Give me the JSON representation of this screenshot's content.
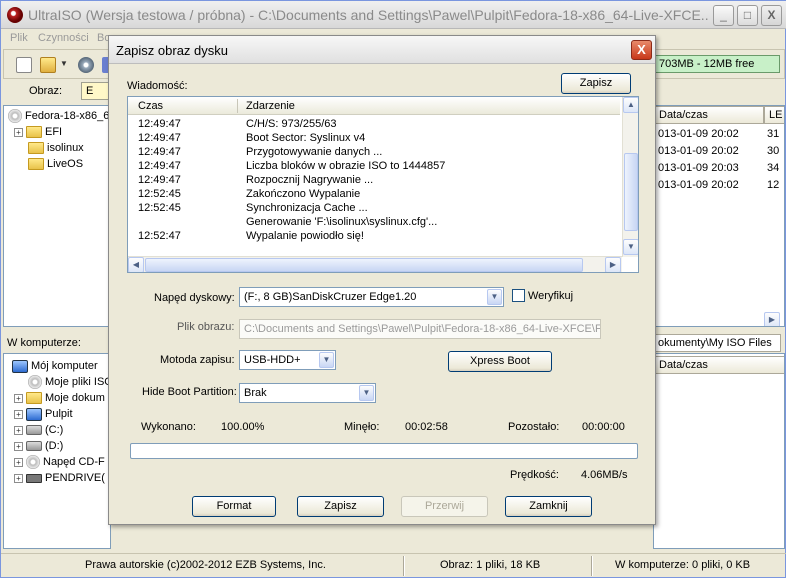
{
  "app": {
    "title": "UltraISO (Wersja testowa / próbna) - C:\\Documents and Settings\\Pawel\\Pulpit\\Fedora-18-x86_64-Live-XFCE...",
    "window_buttons": {
      "minimize": "_",
      "maximize": "□",
      "close": "X"
    }
  },
  "menu": [
    "Plik",
    "Czynności",
    "Bo"
  ],
  "toolbar": {
    "size_info": "703MB - 12MB free"
  },
  "image_bar": {
    "label": "Obraz:",
    "value": "E"
  },
  "iso_tree": {
    "root": "Fedora-18-x86_6",
    "items": [
      {
        "label": "EFI",
        "expander": "+"
      },
      {
        "label": "isolinux",
        "expander": ""
      },
      {
        "label": "LiveOS",
        "expander": ""
      }
    ]
  },
  "iso_list": {
    "headers": {
      "date": "Data/czas",
      "le": "LE"
    },
    "rows": [
      {
        "date": "013-01-09 20:02",
        "le": "31"
      },
      {
        "date": "013-01-09 20:02",
        "le": "30"
      },
      {
        "date": "013-01-09 20:03",
        "le": "34"
      },
      {
        "date": "013-01-09 20:02",
        "le": "12"
      }
    ]
  },
  "local_tree": {
    "label": "W komputerze:",
    "items": [
      {
        "label": "Mój komputer",
        "icon": "pc-icon",
        "expander": ""
      },
      {
        "label": "Moje pliki ISO",
        "icon": "cd-icon",
        "expander": ""
      },
      {
        "label": "Moje dokum",
        "icon": "folder-icon",
        "expander": "+"
      },
      {
        "label": "Pulpit",
        "icon": "pc-icon",
        "expander": "+"
      },
      {
        "label": "(C:)",
        "icon": "drive-icon",
        "expander": "+"
      },
      {
        "label": "(D:)",
        "icon": "drive-icon",
        "expander": "+"
      },
      {
        "label": "Napęd CD-F",
        "icon": "cd-icon",
        "expander": "+"
      },
      {
        "label": "PENDRIVE(",
        "icon": "usb-icon",
        "expander": "+"
      }
    ]
  },
  "local_path": "okumenty\\My ISO Files",
  "local_list_header": "Data/czas",
  "status": {
    "copyright": "Prawa autorskie (c)2002-2012 EZB Systems, Inc.",
    "image": "Obraz: 1 pliki, 18 KB",
    "computer": "W komputerze: 0 pliki, 0 KB"
  },
  "dialog": {
    "title": "Zapisz obraz dysku",
    "close": "X",
    "message_label": "Wiadomość:",
    "save_log_button": "Zapisz",
    "log": {
      "col_time": "Czas",
      "col_event": "Zdarzenie",
      "rows": [
        {
          "time": "12:49:47",
          "event": "C/H/S: 973/255/63"
        },
        {
          "time": "12:49:47",
          "event": "Boot Sector: Syslinux v4"
        },
        {
          "time": "12:49:47",
          "event": "Przygotowywanie danych ..."
        },
        {
          "time": "12:49:47",
          "event": "Liczba bloków w obrazie ISO to 1444857"
        },
        {
          "time": "12:49:47",
          "event": "Rozpocznij Nagrywanie ..."
        },
        {
          "time": "12:52:45",
          "event": "Zakończono Wypalanie"
        },
        {
          "time": "12:52:45",
          "event": "Synchronizacja Cache ..."
        },
        {
          "time": "",
          "event": "Generowanie 'F:\\isolinux\\syslinux.cfg'..."
        },
        {
          "time": "12:52:47",
          "event": "Wypalanie powiodło się!"
        }
      ]
    },
    "drive_label": "Napęd dyskowy:",
    "drive_value": "(F:, 8 GB)SanDiskCruzer Edge1.20",
    "verify_label": "Weryfikuj",
    "image_file_label": "Plik obrazu:",
    "image_file_value": "C:\\Documents and Settings\\Pawel\\Pulpit\\Fedora-18-x86_64-Live-XFCE\\F",
    "write_method_label": "Motoda zapisu:",
    "write_method_value": "USB-HDD+",
    "xpress_boot_button": "Xpress Boot",
    "hide_boot_label": "Hide Boot Partition:",
    "hide_boot_value": "Brak",
    "done_label": "Wykonano:",
    "done_value": "100.00%",
    "elapsed_label": "Minęło:",
    "elapsed_value": "00:02:58",
    "remaining_label": "Pozostało:",
    "remaining_value": "00:00:00",
    "progress_fraction": 0,
    "speed_label": "Prędkość:",
    "speed_value": "4.06MB/s",
    "buttons": {
      "format": "Format",
      "write": "Zapisz",
      "abort": "Przerwij",
      "close": "Zamknij"
    }
  }
}
